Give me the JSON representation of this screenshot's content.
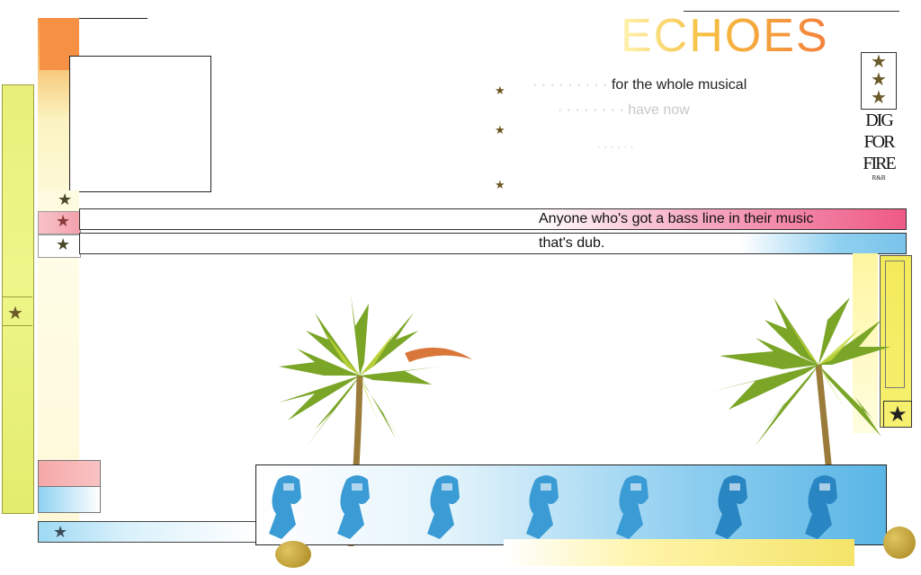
{
  "header": {
    "title": "ECHOES"
  },
  "content": {
    "bullet_lines": [
      "for the whole musical",
      "have now"
    ],
    "highlight_line": "Anyone who's got a bass line in their music",
    "second_line": "that's dub."
  },
  "logo": {
    "words": [
      "DIG",
      "FOR",
      "FIRE"
    ],
    "small": "R&B"
  },
  "colors": {
    "accent_orange": "#f59045",
    "accent_pink": "#ee5a85",
    "accent_blue": "#5ab6e6",
    "accent_yellow": "#f3ea5a"
  }
}
